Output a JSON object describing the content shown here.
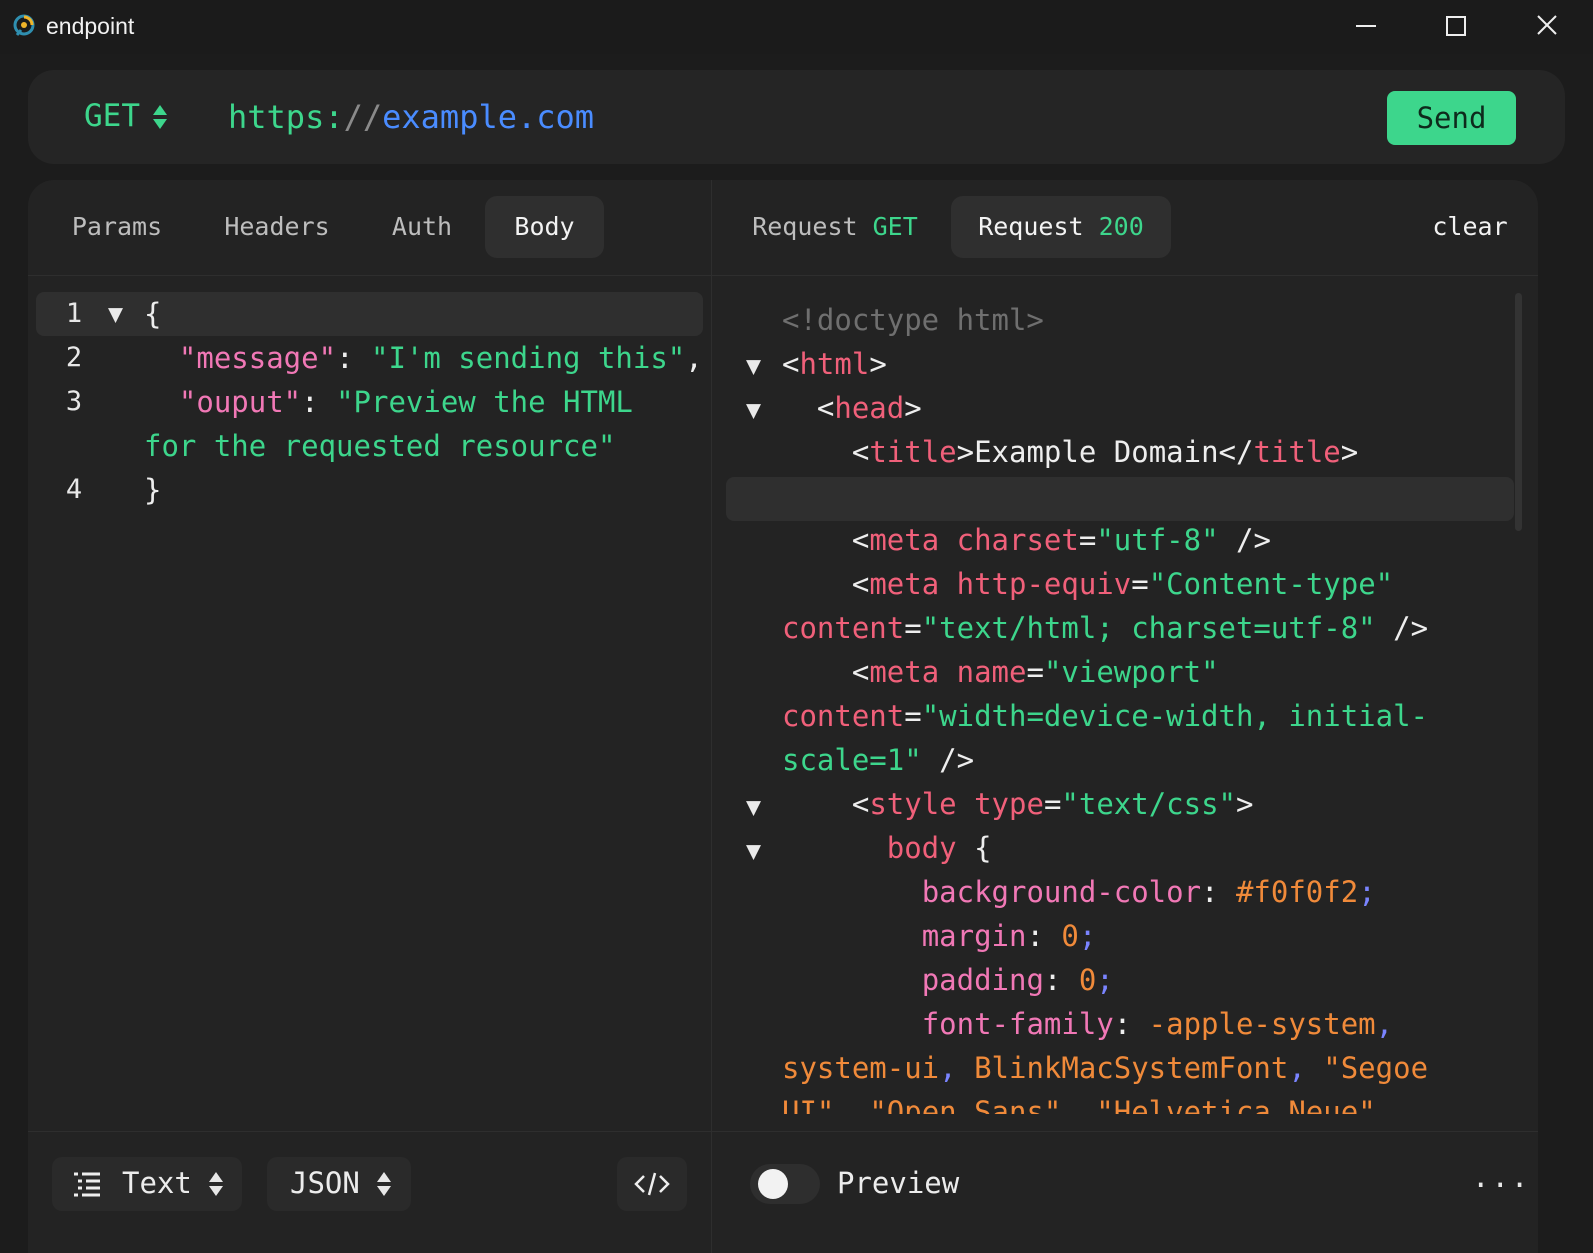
{
  "window": {
    "title": "endpoint",
    "logo_icon": "endpoint-logo-icon",
    "controls": [
      "minimize-icon",
      "maximize-icon",
      "close-icon"
    ]
  },
  "request": {
    "method": "GET",
    "url_scheme": "https:",
    "url_sep": "//",
    "url_host": "example.com",
    "send_label": "Send"
  },
  "left_tabs": [
    "Params",
    "Headers",
    "Auth",
    "Body"
  ],
  "left_active_tab": "Body",
  "right_tabs": {
    "req_label": "Request",
    "req_method": "GET",
    "resp_label": "Request",
    "resp_status": "200",
    "clear_label": "clear"
  },
  "body_editor": {
    "line_numbers": [
      "1",
      "2",
      "3",
      "4"
    ],
    "l1": "{",
    "l2_key": "\"message\"",
    "l2_colon": ": ",
    "l2_val": "\"I'm sending this\"",
    "l2_comma": ",",
    "l3_key": "\"ouput\"",
    "l3_colon": ": ",
    "l3_val_a": "\"Preview the HTML",
    "l3_val_b": "for the requested resource\"",
    "l4": "}"
  },
  "response": {
    "doctype": "<!doctype html>",
    "html_tag": "html",
    "head_tag": "head",
    "title_tag": "title",
    "title_text": "Example Domain",
    "meta": "meta",
    "charset_attr": "charset",
    "charset_val": "\"utf-8\"",
    "http_equiv_attr": "http-equiv",
    "http_equiv_val": "\"Content-type\"",
    "content_attr": "content",
    "content_val_1": "\"text/html; charset=utf-8\"",
    "name_attr": "name",
    "name_val": "\"viewport\"",
    "content_val_2a": "\"width=device-width, initial-",
    "content_val_2b": "scale=1\"",
    "style_tag": "style",
    "type_attr": "type",
    "type_val": "\"text/css\"",
    "selector": "body",
    "p1": "background-color",
    "v1": "#f0f0f2",
    "p2": "margin",
    "v2": "0",
    "p3": "padding",
    "v3": "0",
    "p4": "font-family",
    "v4a": "-apple-system",
    "v4b": "system-ui",
    "v4c": "BlinkMacSystemFont",
    "v4d": "\"Segoe",
    "v4e": "UI\"",
    "v4f": "\"Open Sans\"",
    "v4g": "\"Helvetica Neue\""
  },
  "bottom_left": {
    "format_label": "Text",
    "format_icon": "list-format-icon",
    "lang_label": "JSON",
    "code_icon": "code-icon"
  },
  "bottom_right": {
    "preview_label": "Preview",
    "preview_on": false,
    "more_label": "..."
  },
  "colors": {
    "accent_green": "#3dd68c",
    "url_blue": "#4a8cff",
    "key_pink": "#f178b6",
    "tag_red": "#f0607a",
    "value_orange": "#f08a3a"
  }
}
